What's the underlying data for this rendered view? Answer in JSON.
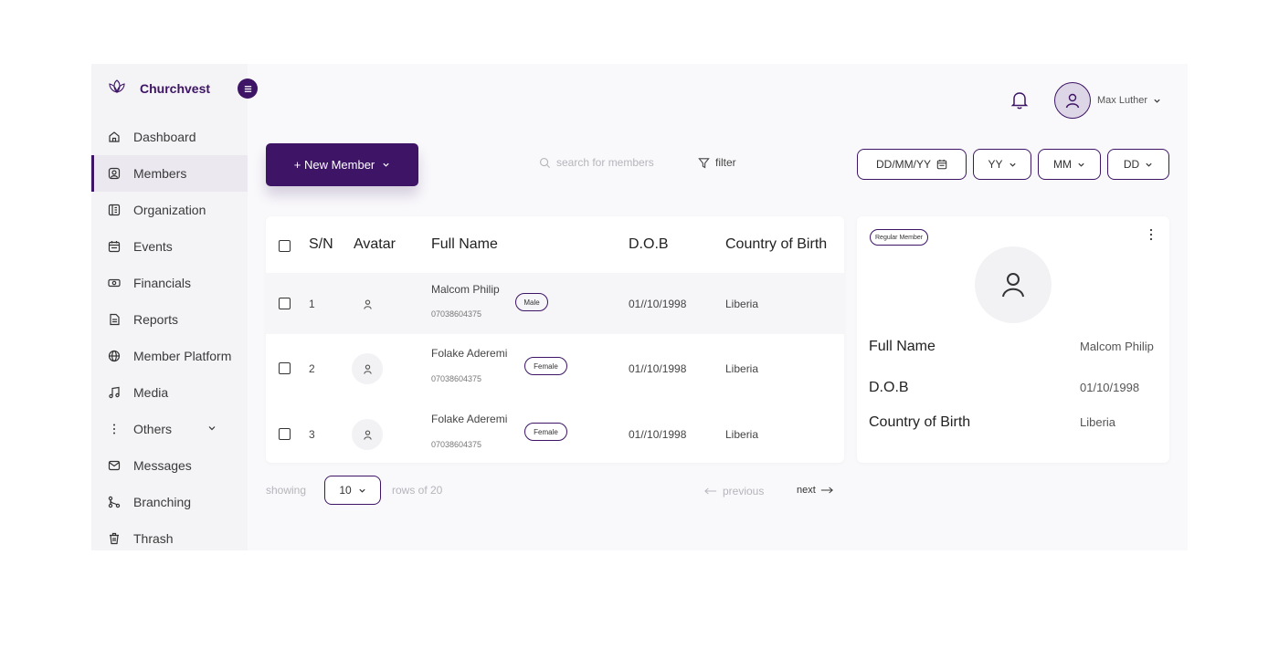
{
  "brand": {
    "name": "Churchvest",
    "accent": "#3d1466"
  },
  "sidebar": {
    "items": [
      {
        "label": "Dashboard",
        "icon": "home-icon"
      },
      {
        "label": "Members",
        "icon": "members-icon",
        "active": true
      },
      {
        "label": "Organization",
        "icon": "organization-icon"
      },
      {
        "label": "Events",
        "icon": "calendar-icon"
      },
      {
        "label": "Financials",
        "icon": "money-icon"
      },
      {
        "label": "Reports",
        "icon": "report-icon"
      },
      {
        "label": "Member Platform",
        "icon": "globe-icon"
      },
      {
        "label": "Media",
        "icon": "music-icon"
      },
      {
        "label": "Others",
        "icon": "more-vertical-icon",
        "has_chevron": true
      },
      {
        "label": "Messages",
        "icon": "mail-icon"
      },
      {
        "label": "Branching",
        "icon": "branch-icon"
      },
      {
        "label": "Thrash",
        "icon": "trash-icon"
      }
    ]
  },
  "header": {
    "user_name": "Max Luther"
  },
  "toolbar": {
    "new_member_label": "+ New Member",
    "search_placeholder": "search for members",
    "filter_label": "filter",
    "date_filters": {
      "full": "DD/MM/YY",
      "year": "YY",
      "month": "MM",
      "day": "DD"
    }
  },
  "table": {
    "headers": {
      "sn": "S/N",
      "avatar": "Avatar",
      "full_name": "Full Name",
      "dob": "D.O.B",
      "country": "Country of Birth"
    },
    "rows": [
      {
        "sn": "1",
        "name": "Malcom Philip",
        "phone": "07038604375",
        "gender": "Male",
        "dob": "01//10/1998",
        "country": "Liberia"
      },
      {
        "sn": "2",
        "name": "Folake Aderemi",
        "phone": "07038604375",
        "gender": "Female",
        "dob": "01//10/1998",
        "country": "Liberia"
      },
      {
        "sn": "3",
        "name": "Folake Aderemi",
        "phone": "07038604375",
        "gender": "Female",
        "dob": "01//10/1998",
        "country": "Liberia"
      }
    ]
  },
  "pagination": {
    "showing_label": "showing",
    "rows_value": "10",
    "rows_of_label": "rows of 20",
    "previous_label": "previous",
    "next_label": "next"
  },
  "detail": {
    "badge": "Regular Member",
    "fields": [
      {
        "label": "Full Name",
        "value": "Malcom Philip"
      },
      {
        "label": "D.O.B",
        "value": "01/10/1998"
      },
      {
        "label": "Country of Birth",
        "value": "Liberia"
      }
    ]
  }
}
